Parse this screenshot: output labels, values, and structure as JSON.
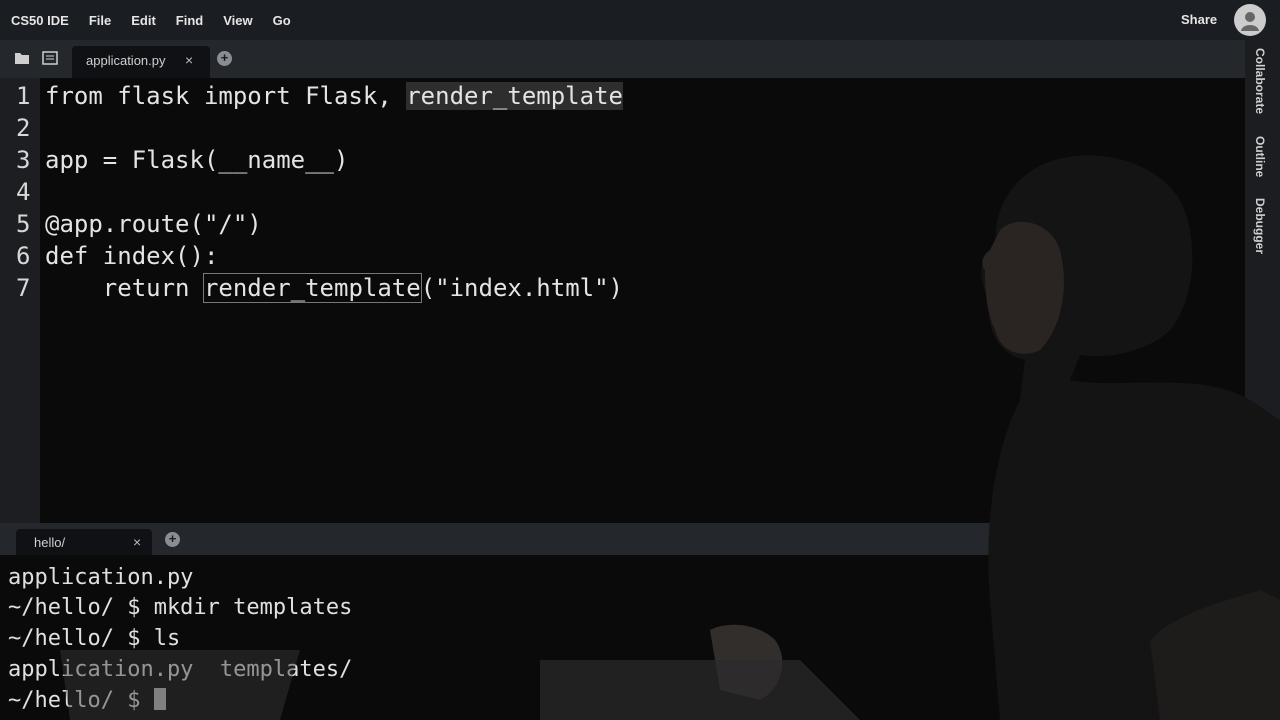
{
  "menubar": {
    "brand": "CS50 IDE",
    "items": [
      "File",
      "Edit",
      "Find",
      "View",
      "Go"
    ],
    "share": "Share"
  },
  "right_panel": {
    "tabs": [
      "Collaborate",
      "Outline",
      "Debugger"
    ]
  },
  "editor": {
    "tab_label": "application.py",
    "close_glyph": "×",
    "add_glyph": "+",
    "lines": [
      {
        "n": "1",
        "text": "from flask import Flask, "
      },
      {
        "n": "2",
        "text": ""
      },
      {
        "n": "3",
        "text": "app = Flask(__name__)"
      },
      {
        "n": "4",
        "text": ""
      },
      {
        "n": "5",
        "text": "@app.route(\"/\")"
      },
      {
        "n": "6",
        "text": "def index():"
      },
      {
        "n": "7",
        "text": "    return "
      }
    ],
    "line1_highlight": "render_template",
    "line7_call": "render_template",
    "line7_arg": "(\"index.html\")"
  },
  "terminal": {
    "tab_label": "hello/",
    "close_glyph": "×",
    "add_glyph": "+",
    "lines": [
      "application.py",
      "~/hello/ $ mkdir templates",
      "~/hello/ $ ls",
      "application.py  templates/",
      "~/hello/ $ "
    ]
  },
  "icons": {
    "folder": "folder-icon",
    "list": "file-list-icon",
    "avatar": "user-avatar-icon"
  }
}
